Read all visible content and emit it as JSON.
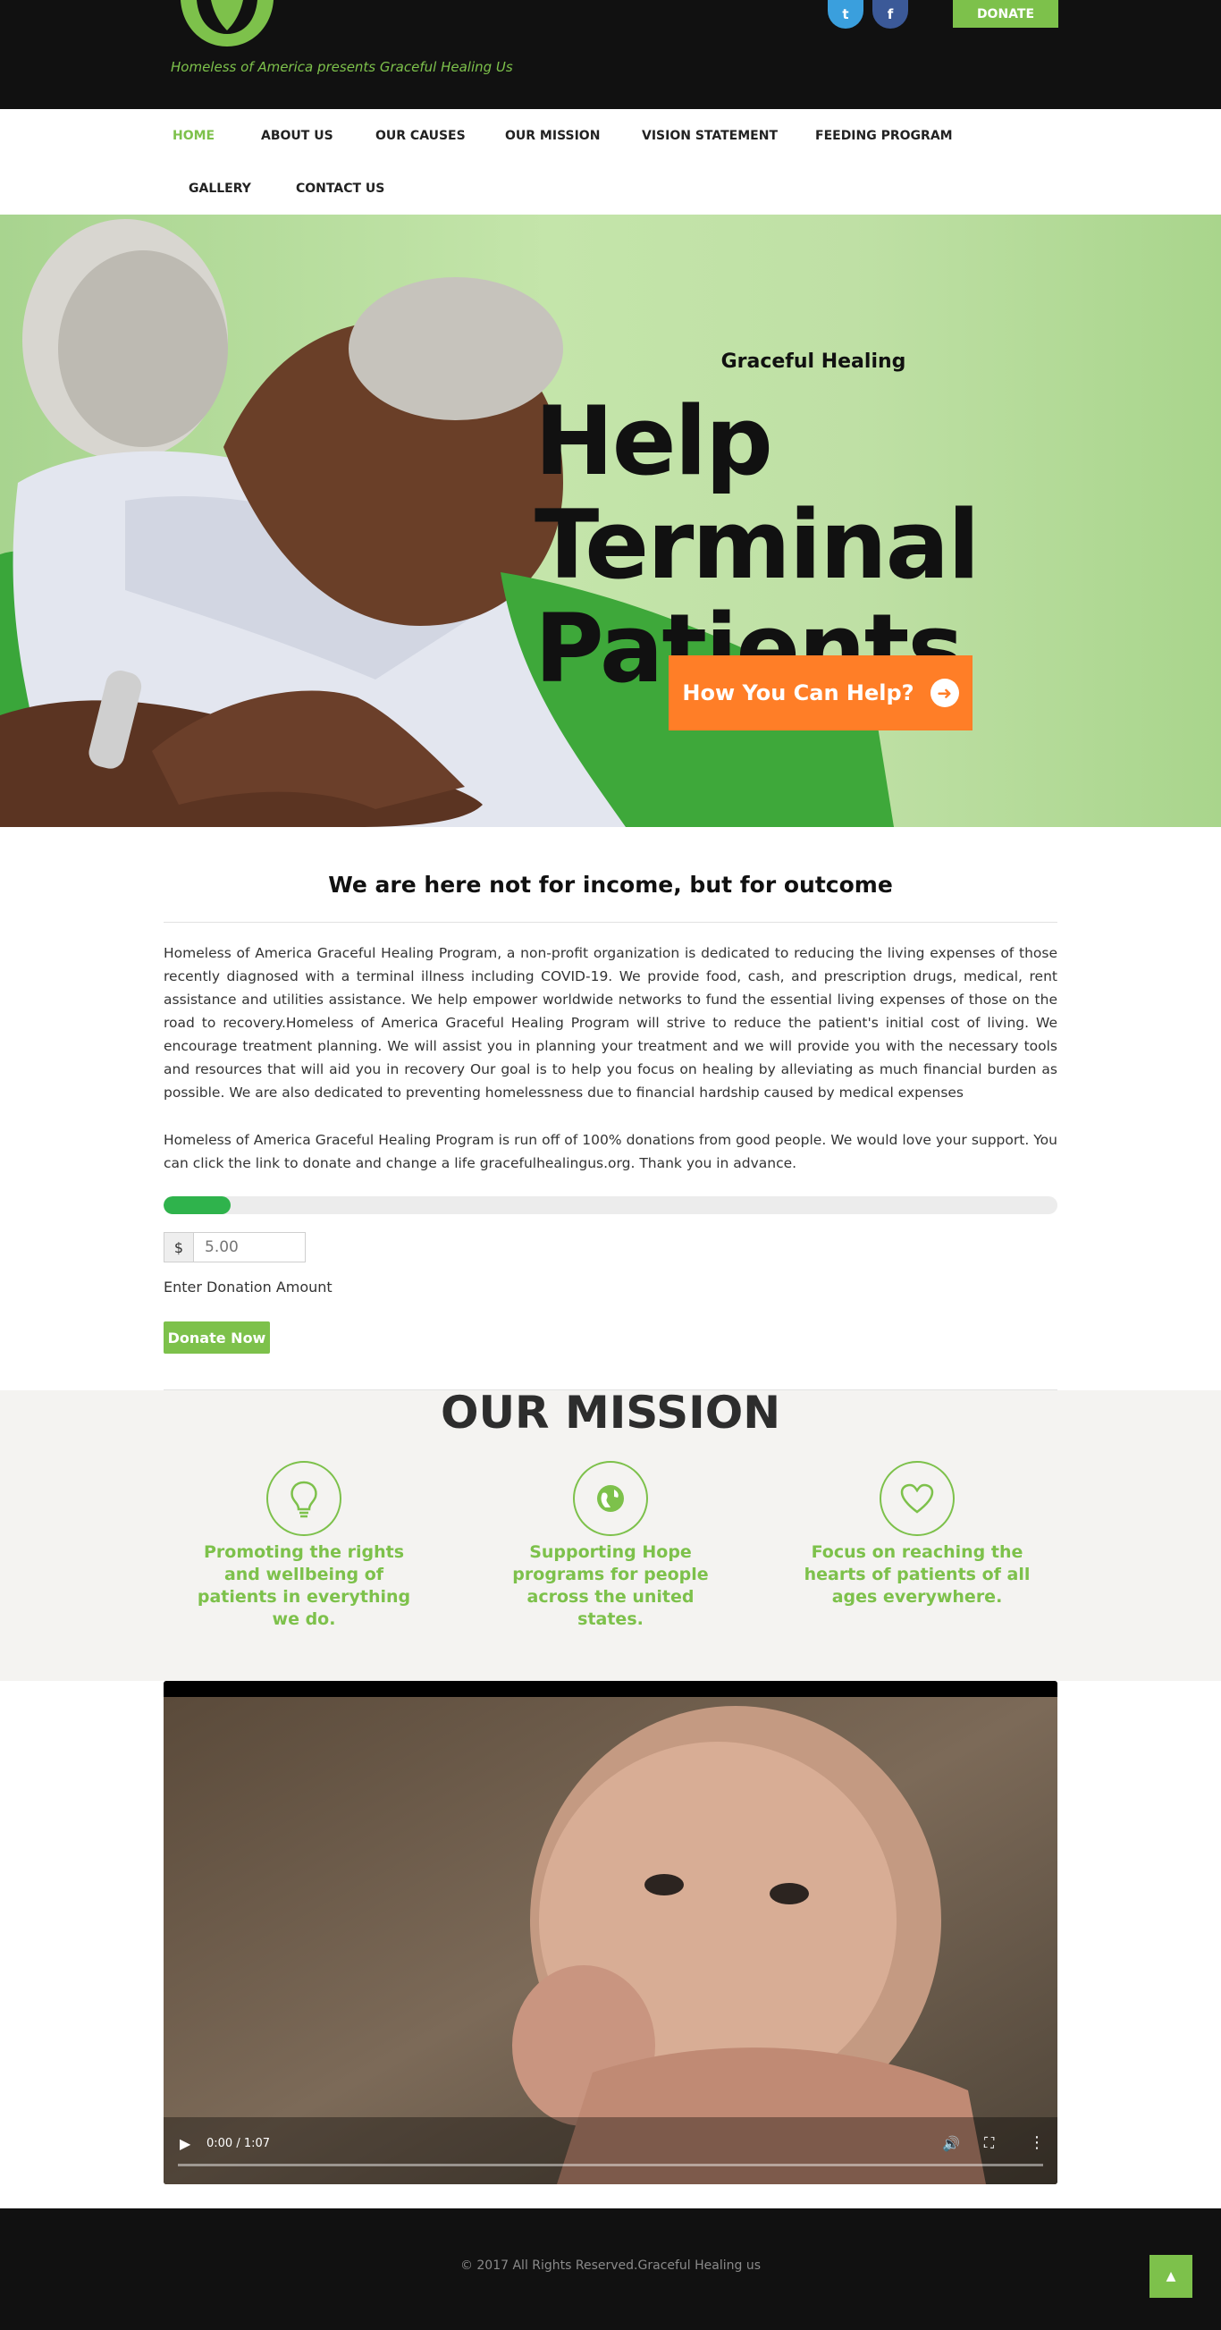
{
  "header": {
    "tagline": "Homeless of America presents Graceful Healing Us",
    "social": [
      {
        "icon": "twitter-icon",
        "glyph": "t"
      },
      {
        "icon": "facebook-icon",
        "glyph": "f"
      }
    ],
    "donate_label": "DONATE"
  },
  "nav": {
    "items": [
      {
        "label": "HOME",
        "active": true
      },
      {
        "label": "ABOUT US"
      },
      {
        "label": "OUR CAUSES"
      },
      {
        "label": "OUR MISSION"
      },
      {
        "label": "VISION STATEMENT"
      },
      {
        "label": "FEEDING PROGRAM"
      },
      {
        "label": "GALLERY"
      },
      {
        "label": "CONTACT US"
      }
    ]
  },
  "hero": {
    "subtitle": "Graceful Healing",
    "title_line1": "Help Terminal",
    "title_line2": "Patients",
    "button_label": "How You Can Help?",
    "button_icon": "arrow-right-circle-icon"
  },
  "about": {
    "heading": "We are here not for income, but for outcome",
    "paragraph1": "Homeless of America Graceful Healing Program, a non-profit organization is dedicated to reducing the living expenses of those recently diagnosed with a terminal illness including COVID-19. We provide food, cash, and prescription drugs, medical, rent assistance and utilities assistance. We help empower worldwide networks to fund the essential living expenses of those on the road to recovery.Homeless of America Graceful Healing Program will strive to reduce the patient's initial cost of living. We encourage treatment planning. We will assist you in planning your treatment and we will provide you with the necessary tools and resources that will aid you in recovery Our goal is to help you focus on healing by alleviating as much financial burden as possible. We are also dedicated to preventing homelessness due to financial hardship caused by medical expenses",
    "paragraph2": "Homeless of America Graceful Healing Program is run off of 100% donations from good people. We would love your support. You can click the link to donate and change a life gracefulhealingus.org. Thank you in advance.",
    "progress_fraction": 0.075,
    "currency_symbol": "$",
    "amount_placeholder": "5.00",
    "amount_label": "Enter Donation Amount",
    "donate_now_label": "Donate Now"
  },
  "mission": {
    "title": "OUR MISSION",
    "items": [
      {
        "icon": "lightbulb-icon",
        "text": "Promoting the rights and wellbeing of patients in everything we do."
      },
      {
        "icon": "globe-icon",
        "text": "Supporting Hope programs for people across the united states."
      },
      {
        "icon": "heart-icon",
        "text": "Focus on reaching the hearts of patients of all ages everywhere."
      }
    ]
  },
  "video": {
    "time": "0:00 / 1:07"
  },
  "footer": {
    "copyright": "© 2017 All Rights Reserved.Graceful Healing us",
    "to_top_icon": "chevron-up-icon"
  },
  "colors": {
    "brand_green": "#7dc14b",
    "accent_orange": "#ff7e27",
    "progress_green": "#2fb34c",
    "dark": "#111111"
  }
}
